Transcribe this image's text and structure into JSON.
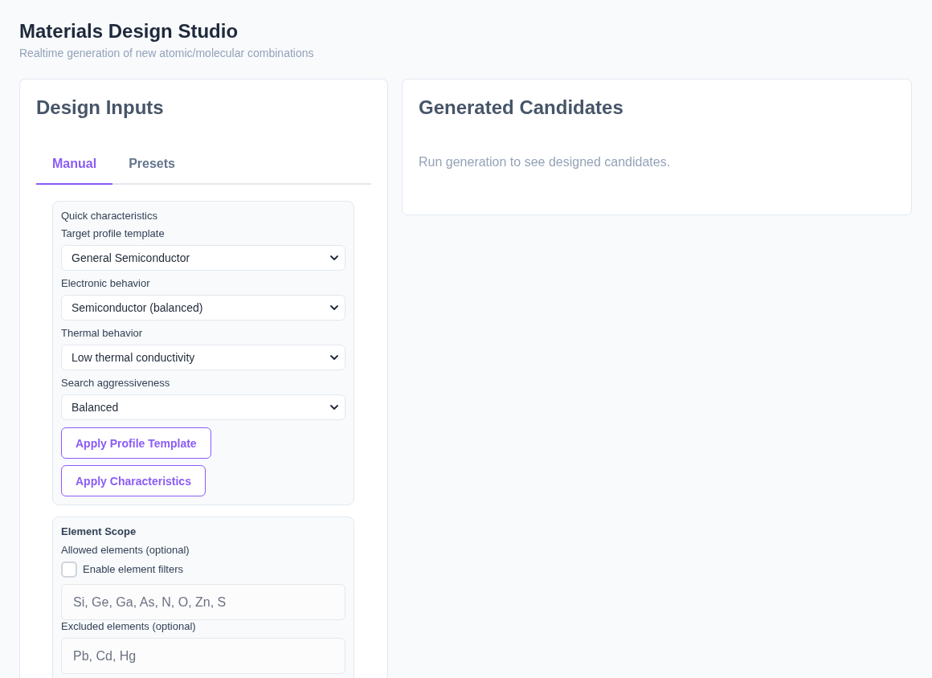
{
  "header": {
    "title": "Materials Design Studio",
    "subtitle": "Realtime generation of new atomic/molecular combinations"
  },
  "design_inputs": {
    "title": "Design Inputs",
    "tabs": [
      {
        "label": "Manual",
        "selected": true
      },
      {
        "label": "Presets",
        "selected": false
      }
    ],
    "quick_characteristics": {
      "heading": "Quick characteristics",
      "fields": [
        {
          "label": "Target profile template",
          "value": "General Semiconductor"
        },
        {
          "label": "Electronic behavior",
          "value": "Semiconductor (balanced)"
        },
        {
          "label": "Thermal behavior",
          "value": "Low thermal conductivity"
        },
        {
          "label": "Search aggressiveness",
          "value": "Balanced"
        }
      ],
      "buttons": [
        "Apply Profile Template",
        "Apply Characteristics"
      ]
    },
    "element_scope": {
      "heading": "Element Scope",
      "allowed": {
        "label": "Allowed elements (optional)",
        "filter_checkbox": {
          "label": "Enable element filters",
          "checked": false
        },
        "placeholder": "Si, Ge, Ga, As, N, O, Zn, S"
      },
      "excluded": {
        "label": "Excluded elements (optional)",
        "placeholder": "Pb, Cd, Hg"
      }
    }
  },
  "generated_candidates": {
    "title": "Generated Candidates",
    "empty_message": "Run generation to see designed candidates."
  }
}
